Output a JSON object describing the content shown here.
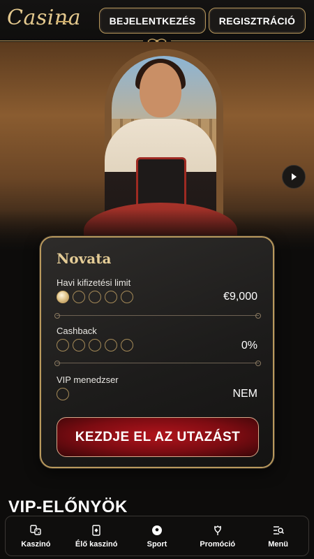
{
  "header": {
    "logo": "Casina",
    "login_label": "BEJELENTKEZÉS",
    "register_label": "REGISZTRÁCIÓ"
  },
  "hero": {
    "next_icon": "play-arrow-icon"
  },
  "card": {
    "title": "Novata",
    "rows": [
      {
        "label": "Havi kifizetési limit",
        "value": "€9,000",
        "dots_total": 5,
        "dots_filled": 1
      },
      {
        "label": "Cashback",
        "value": "0%",
        "dots_total": 5,
        "dots_filled": 0
      },
      {
        "label": "VIP menedzser",
        "value": "NEM",
        "dots_total": 1,
        "dots_filled": 0
      }
    ],
    "cta_label": "KEZDJE EL AZ UTAZÁST"
  },
  "section_heading": "VIP-ELŐNYÖK",
  "bottom_nav": {
    "items": [
      {
        "label": "Kaszinó",
        "icon": "dice-cards-icon"
      },
      {
        "label": "Élő kaszinó",
        "icon": "playing-card-icon"
      },
      {
        "label": "Sport",
        "icon": "soccer-ball-icon"
      },
      {
        "label": "Promóció",
        "icon": "tulip-icon"
      },
      {
        "label": "Menü",
        "icon": "menu-search-icon"
      }
    ]
  },
  "colors": {
    "gold": "#b9995d",
    "cta_red": "#9e1018",
    "background": "#0d0c0b"
  }
}
